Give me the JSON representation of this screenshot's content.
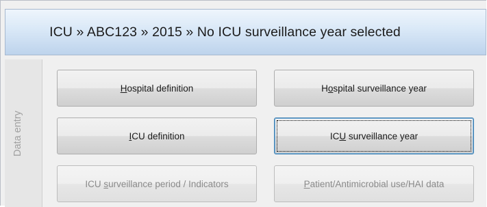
{
  "header": {
    "title": "ICU » ABC123 » 2015 » No ICU surveillance year selected"
  },
  "side_tab": {
    "label": "Data entry"
  },
  "buttons": {
    "hospital_definition": {
      "pre": "",
      "key": "H",
      "post": "ospital definition"
    },
    "hospital_surveillance_year": {
      "pre": "H",
      "key": "o",
      "post": "spital surveillance year"
    },
    "icu_definition": {
      "pre": "",
      "key": "I",
      "post": "CU definition"
    },
    "icu_surveillance_year": {
      "pre": "IC",
      "key": "U",
      "post": " surveillance year"
    },
    "icu_surveillance_period": {
      "pre": "ICU ",
      "key": "s",
      "post": "urveillance period / Indicators"
    },
    "patient_data": {
      "pre": "",
      "key": "P",
      "post": "atient/Antimicrobial use/HAI data"
    }
  }
}
